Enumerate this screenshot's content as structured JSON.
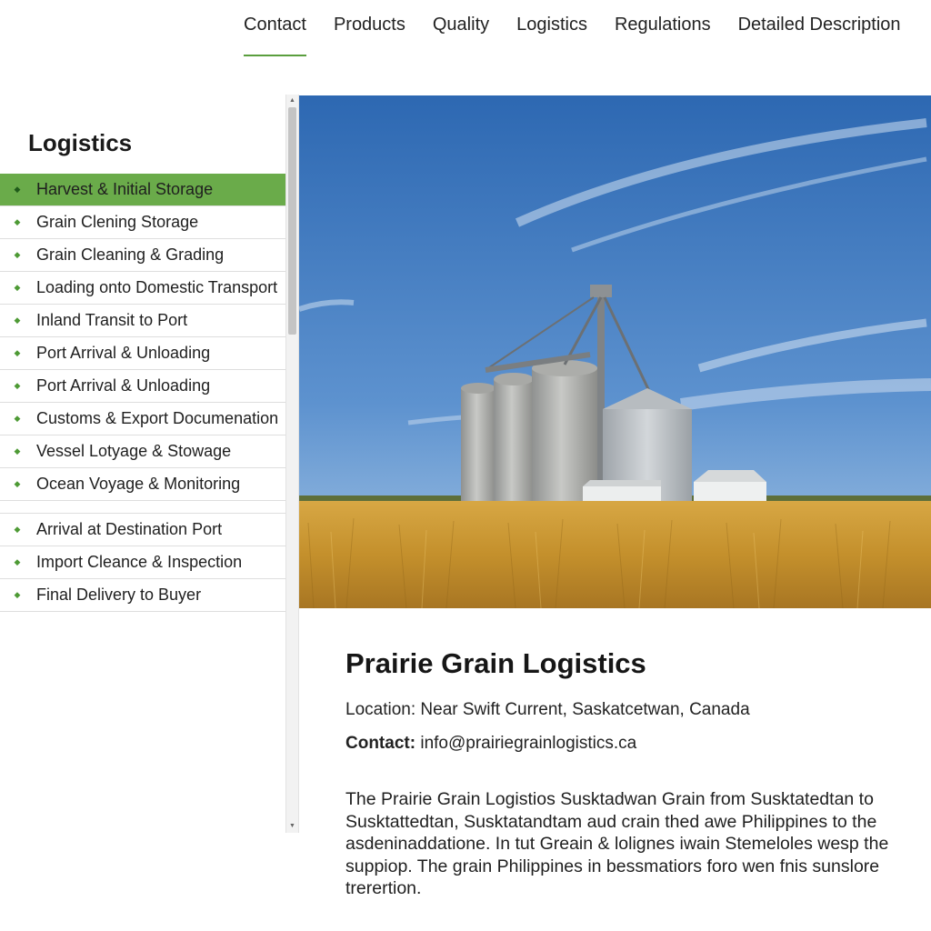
{
  "nav": {
    "tabs": [
      {
        "label": "Contact",
        "active": true
      },
      {
        "label": "Products",
        "active": false
      },
      {
        "label": "Quality",
        "active": false
      },
      {
        "label": "Logistics",
        "active": false
      },
      {
        "label": "Regulations",
        "active": false
      },
      {
        "label": "Detailed Description",
        "active": false
      }
    ],
    "accent_color": "#5a9e3e"
  },
  "sidebar": {
    "title": "Logistics",
    "active_color": "#6aab4a",
    "items": [
      {
        "label": "Harvest & Initial Storage",
        "active": true
      },
      {
        "label": "Grain Clening Storage",
        "active": false
      },
      {
        "label": "Grain Cleaning & Grading",
        "active": false
      },
      {
        "label": "Loading onto Domestic Transport",
        "active": false
      },
      {
        "label": "Inland Transit to Port",
        "active": false
      },
      {
        "label": "Port Arrival & Unloading",
        "active": false
      },
      {
        "label": "Port Arrival & Unloading",
        "active": false
      },
      {
        "label": "Customs & Export Documenation",
        "active": false
      },
      {
        "label": "Vessel Lotyage & Stowage",
        "active": false
      },
      {
        "label": "Ocean Voyage & Monitoring",
        "active": false
      },
      {
        "label": "Arrival at Destination Port",
        "active": false
      },
      {
        "label": "Import Cleance & Inspection",
        "active": false
      },
      {
        "label": "Final Delivery to Buyer",
        "active": false
      }
    ],
    "scrollbar": {
      "scroll_position": 0
    }
  },
  "hero": {
    "icon": "grain-elevator-photo",
    "sky_color": "#2f6db5",
    "field_color": "#c9962f"
  },
  "details": {
    "title": "Prairie Grain Logistics",
    "location_label": "Location:",
    "location_value": "Near Swift Current, Saskatcetwan, Canada",
    "contact_label": "Contact:",
    "contact_value": "info@prairiegrainlogistics.ca",
    "description": "The Prairie Grain Logistios Susktadwan Grain from Susktatedtan to Susktattedtan, Susktatandtam aud crain thed awe Philippines to the asdeninaddatione. In tut Greain & lolignes iwain Stemeloles wesp the suppiop. The grain Philippines in bessmatiors foro wen fnis sunslore trerertion."
  }
}
